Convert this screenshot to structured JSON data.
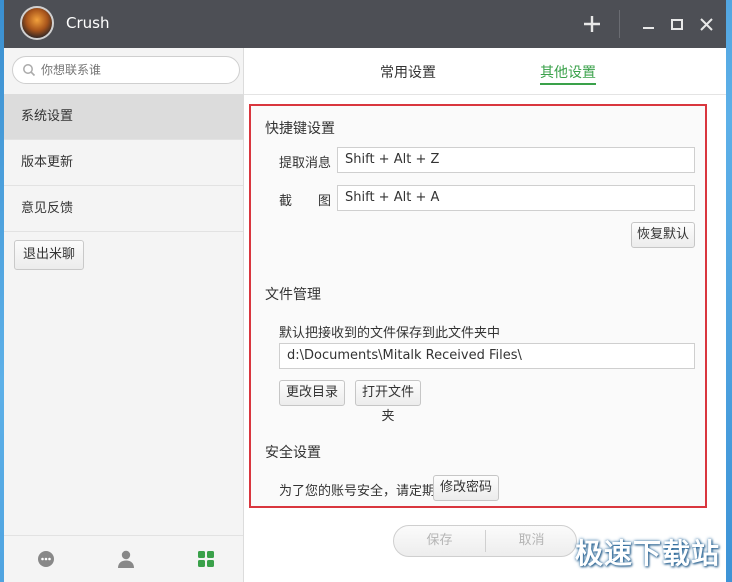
{
  "window": {
    "title": "Crush"
  },
  "sidebar": {
    "search_placeholder": "你想联系谁",
    "items": [
      {
        "label": "系统设置"
      },
      {
        "label": "版本更新"
      },
      {
        "label": "意见反馈"
      }
    ],
    "logout_label": "退出米聊"
  },
  "tabs": [
    {
      "label": "常用设置"
    },
    {
      "label": "其他设置"
    }
  ],
  "shortcuts": {
    "title": "快捷键设置",
    "rows": [
      {
        "label": "提取消息",
        "value": "Shift + Alt + Z"
      },
      {
        "label": "截　　图",
        "value": "Shift + Alt + A"
      }
    ],
    "restore_label": "恢复默认"
  },
  "files": {
    "title": "文件管理",
    "description": "默认把接收到的文件保存到此文件夹中",
    "path": "d:\\Documents\\Mitalk Received Files\\",
    "change_dir_label": "更改目录",
    "open_folder_label": "打开文件夹"
  },
  "security": {
    "title": "安全设置",
    "hint": "为了您的账号安全，请定期",
    "change_password_label": "修改密码"
  },
  "footer": {
    "save_label": "保存",
    "cancel_label": "取消"
  },
  "watermark": "极速下载站",
  "colors": {
    "accent": "#3aa14a",
    "highlight_border": "#d9363e",
    "titlebar": "#4d4f55"
  }
}
